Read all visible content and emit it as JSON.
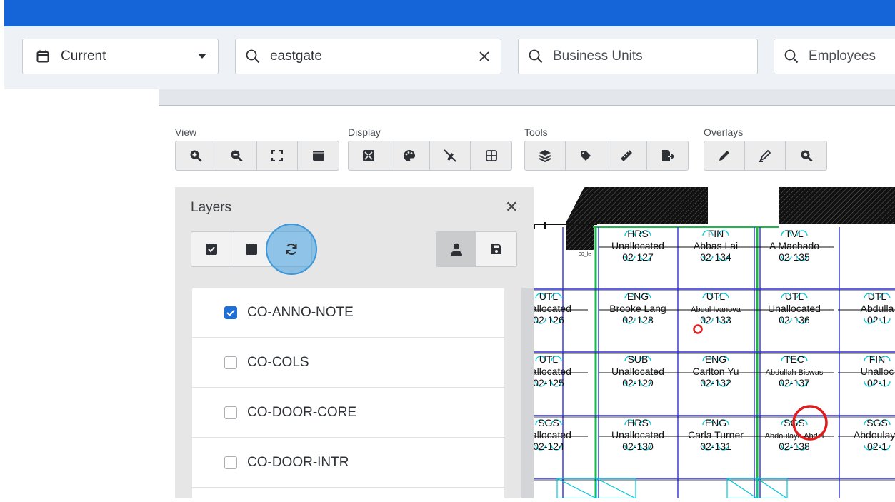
{
  "filters": {
    "period": {
      "value": "Current"
    },
    "location_search": {
      "value": "eastgate"
    },
    "business_units": {
      "placeholder": "Business Units"
    },
    "employees": {
      "placeholder": "Employees"
    }
  },
  "toolbar": {
    "groups": [
      {
        "label": "View",
        "buttons": [
          "zoom-in",
          "zoom-out",
          "fit-screen",
          "window"
        ]
      },
      {
        "label": "Display",
        "buttons": [
          "expand",
          "palette",
          "hide",
          "grid"
        ]
      },
      {
        "label": "Tools",
        "buttons": [
          "layers",
          "tag",
          "ruler",
          "export"
        ]
      },
      {
        "label": "Overlays",
        "buttons": [
          "pen",
          "highlighter",
          "search"
        ]
      }
    ]
  },
  "layers_panel": {
    "title": "Layers",
    "items": [
      {
        "label": "CO-ANNO-NOTE",
        "checked": true
      },
      {
        "label": "CO-COLS",
        "checked": false
      },
      {
        "label": "CO-DOOR-CORE",
        "checked": false
      },
      {
        "label": "CO-DOOR-INTR",
        "checked": false
      }
    ]
  },
  "floorplan": {
    "rooms": [
      {
        "unit": "HRS",
        "name": "Unallocated",
        "room": "02-127"
      },
      {
        "unit": "FIN",
        "name": "Abbas Lai",
        "room": "02-134"
      },
      {
        "unit": "TVL",
        "name": "A Machado",
        "room": "02-135"
      },
      {
        "unit": "UTL",
        "name": "nallocated",
        "room": "02-126"
      },
      {
        "unit": "ENG",
        "name": "Brooke Lang",
        "room": "02-128"
      },
      {
        "unit": "UTL",
        "name": "Abdul Ivanova",
        "room": "02-133"
      },
      {
        "unit": "UTL",
        "name": "Unallocated",
        "room": "02-136"
      },
      {
        "unit": "UTL",
        "name": "Abdulla",
        "room": "02-1"
      },
      {
        "unit": "UTL",
        "name": "nallocated",
        "room": "02-125"
      },
      {
        "unit": "SUB",
        "name": "Unallocated",
        "room": "02-129"
      },
      {
        "unit": "ENG",
        "name": "Carlton Yu",
        "room": "02-132"
      },
      {
        "unit": "TEC",
        "name": "Abdullah Biswas",
        "room": "02-137"
      },
      {
        "unit": "FIN",
        "name": "Unalloc",
        "room": "02-1"
      },
      {
        "unit": "SGS",
        "name": "nallocated",
        "room": "02-124"
      },
      {
        "unit": "HRS",
        "name": "Unallocated",
        "room": "02-130"
      },
      {
        "unit": "ENG",
        "name": "Carla Turner",
        "room": "02-131"
      },
      {
        "unit": "SGS",
        "name": "Abdoulaye Abdel",
        "room": "02-138"
      },
      {
        "unit": "SGS",
        "name": "Abdoulaye",
        "room": "02-1"
      }
    ]
  }
}
